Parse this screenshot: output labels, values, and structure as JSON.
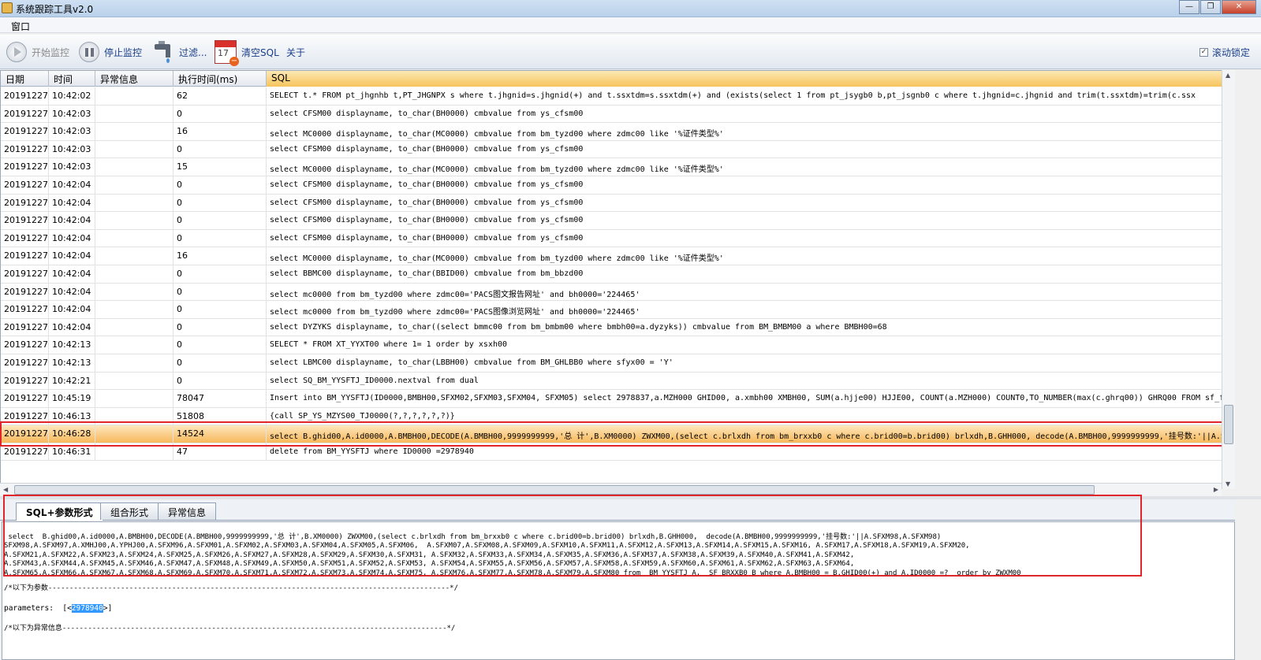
{
  "window": {
    "title": "系统跟踪工具v2.0",
    "buttons": [
      "—",
      "❐",
      "✕"
    ]
  },
  "menu": {
    "items": [
      "窗口"
    ]
  },
  "toolbar": {
    "start": "开始监控",
    "stop": "停止监控",
    "filter": "过滤...",
    "clear": "清空SQL",
    "about": "关于",
    "scroll_lock": "滚动锁定",
    "scroll_lock_checked": "✓",
    "cal_num": "17"
  },
  "grid": {
    "headers": [
      "日期",
      "时间",
      "异常信息",
      "执行时间(ms)",
      "SQL"
    ],
    "rows": [
      [
        "20191227",
        "10:42:02",
        "",
        "62",
        "SELECT t.* FROM pt_jhgnhb t,PT_JHGNPX s where t.jhgnid=s.jhgnid(+) and t.ssxtdm=s.ssxtdm(+)   and (exists(select 1 from pt_jsygb0 b,pt_jsgnb0 c where t.jhgnid=c.jhgnid        and trim(t.ssxtdm)=trim(c.ssx"
      ],
      [
        "20191227",
        "10:42:03",
        "",
        "0",
        "select CFSM00  displayname, to_char(BH0000)  cmbvalue from ys_cfsm00"
      ],
      [
        "20191227",
        "10:42:03",
        "",
        "16",
        "select MC0000  displayname, to_char(MC0000)  cmbvalue from bm_tyzd00  where zdmc00 like '%证件类型%'"
      ],
      [
        "20191227",
        "10:42:03",
        "",
        "0",
        "select CFSM00  displayname, to_char(BH0000)  cmbvalue from ys_cfsm00"
      ],
      [
        "20191227",
        "10:42:03",
        "",
        "15",
        "select MC0000  displayname, to_char(MC0000)  cmbvalue from bm_tyzd00  where zdmc00 like '%证件类型%'"
      ],
      [
        "20191227",
        "10:42:04",
        "",
        "0",
        "select CFSM00  displayname, to_char(BH0000)  cmbvalue from ys_cfsm00"
      ],
      [
        "20191227",
        "10:42:04",
        "",
        "0",
        "select CFSM00  displayname, to_char(BH0000)  cmbvalue from ys_cfsm00"
      ],
      [
        "20191227",
        "10:42:04",
        "",
        "0",
        "select CFSM00  displayname, to_char(BH0000)  cmbvalue from ys_cfsm00"
      ],
      [
        "20191227",
        "10:42:04",
        "",
        "0",
        "select CFSM00  displayname, to_char(BH0000)  cmbvalue from ys_cfsm00"
      ],
      [
        "20191227",
        "10:42:04",
        "",
        "16",
        "select MC0000  displayname, to_char(MC0000)  cmbvalue from bm_tyzd00  where zdmc00 like '%证件类型%'"
      ],
      [
        "20191227",
        "10:42:04",
        "",
        "0",
        "select BBMC00  displayname, to_char(BBID00)  cmbvalue from bm_bbzd00"
      ],
      [
        "20191227",
        "10:42:04",
        "",
        "0",
        "select mc0000 from bm_tyzd00 where zdmc00='PACS图文报告网址' and bh0000='224465'"
      ],
      [
        "20191227",
        "10:42:04",
        "",
        "0",
        "select mc0000 from bm_tyzd00 where zdmc00='PACS图像浏览网址' and bh0000='224465'"
      ],
      [
        "20191227",
        "10:42:04",
        "",
        "0",
        "select DYZYKS  displayname, to_char((select bmmc00 from bm_bmbm00 where bmbh00=a.dyzyks))  cmbvalue from BM_BMBM00 a   where BMBH00=68"
      ],
      [
        "20191227",
        "10:42:13",
        "",
        "0",
        "SELECT * FROM XT_YYXT00 where 1= 1 order by xsxh00"
      ],
      [
        "20191227",
        "10:42:13",
        "",
        "0",
        "select LBMC00  displayname, to_char(LBBH00)  cmbvalue from BM_GHLBB0  where sfyx00 = 'Y'"
      ],
      [
        "20191227",
        "10:42:21",
        "",
        "0",
        " select SQ_BM_YYSFTJ_ID0000.nextval from dual"
      ],
      [
        "20191227",
        "10:45:19",
        "",
        "78047",
        " Insert into  BM_YYSFTJ(ID0000,BMBH00,SFXM02,SFXM03,SFXM04, SFXM05)  select 2978837,a.MZH000 GHID00, a.xmbh00 XMBH00, SUM(a.hjje00) HJJE00,  COUNT(a.MZH000) COUNT0,TO_NUMBER(max(c.ghrq00)) GHRQ00 FROM sf_fy"
      ],
      [
        "20191227",
        "10:46:13",
        "",
        "51808",
        "{call SP_YS_MZYS00_TJ0000(?,?,?,?,?,?)}"
      ],
      [
        "20191227",
        "10:46:28",
        "",
        "14524",
        "  select  B.ghid00,A.id0000,A.BMBH00,DECODE(A.BMBH00,9999999999,'总 计',B.XM0000) ZWXM00,(select c.brlxdh from bm_brxxb0 c where c.brid00=b.brid00) brlxdh,B.GHH000,  decode(A.BMBH00,9999999999,'挂号数:'||A.SF"
      ],
      [
        "20191227",
        "10:46:31",
        "",
        "47",
        "delete from BM_YYSFTJ where ID0000 =2978940"
      ]
    ],
    "selected_index": 19
  },
  "tabs": [
    "SQL+参数形式",
    "组合形式",
    "异常信息"
  ],
  "detail": {
    "sql_lines": [
      " select  B.ghid00,A.id0000,A.BMBH00,DECODE(A.BMBH00,9999999999,'总 计',B.XM0000) ZWXM00,(select c.brlxdh from bm_brxxb0 c where c.brid00=b.brid00) brlxdh,B.GHH000,  decode(A.BMBH00,9999999999,'挂号数:'||A.SFXM98,A.SFXM98)",
      "SFXM98,A.SFXM97,A.XMHJ00,A.YPHJ00,A.SFXM96,A.SFXM01,A.SFXM02,A.SFXM03,A.SFXM04,A.SFXM05,A.SFXM06,  A.SFXM07,A.SFXM08,A.SFXM09,A.SFXM10,A.SFXM11,A.SFXM12,A.SFXM13,A.SFXM14,A.SFXM15,A.SFXM16, A.SFXM17,A.SFXM18,A.SFXM19,A.SFXM20,",
      "A.SFXM21,A.SFXM22,A.SFXM23,A.SFXM24,A.SFXM25,A.SFXM26,A.SFXM27,A.SFXM28,A.SFXM29,A.SFXM30,A.SFXM31, A.SFXM32,A.SFXM33,A.SFXM34,A.SFXM35,A.SFXM36,A.SFXM37,A.SFXM38,A.SFXM39,A.SFXM40,A.SFXM41,A.SFXM42,",
      "A.SFXM43,A.SFXM44,A.SFXM45,A.SFXM46,A.SFXM47,A.SFXM48,A.SFXM49,A.SFXM50,A.SFXM51,A.SFXM52,A.SFXM53, A.SFXM54,A.SFXM55,A.SFXM56,A.SFXM57,A.SFXM58,A.SFXM59,A.SFXM60,A.SFXM61,A.SFXM62,A.SFXM63,A.SFXM64,",
      "A.SFXM65,A.SFXM66,A.SFXM67,A.SFXM68,A.SFXM69,A.SFXM70,A.SFXM71,A.SFXM72,A.SFXM73,A.SFXM74,A.SFXM75, A.SFXM76,A.SFXM77,A.SFXM78,A.SFXM79,A.SFXM80 from  BM_YYSFTJ A,  SF_BRXXB0 B where A.BMBH00 = B.GHID00(+) and A.ID0000 =?  order by ZWXM00"
    ],
    "params_header": "/*以下为参数----------------------------------------------------------------------------------------------*/",
    "params_label": "parameters:  [<",
    "params_value": "2978940",
    "params_end": ">]",
    "error_header": "/*以下为异常信息------------------------------------------------------------------------------------------*/"
  }
}
